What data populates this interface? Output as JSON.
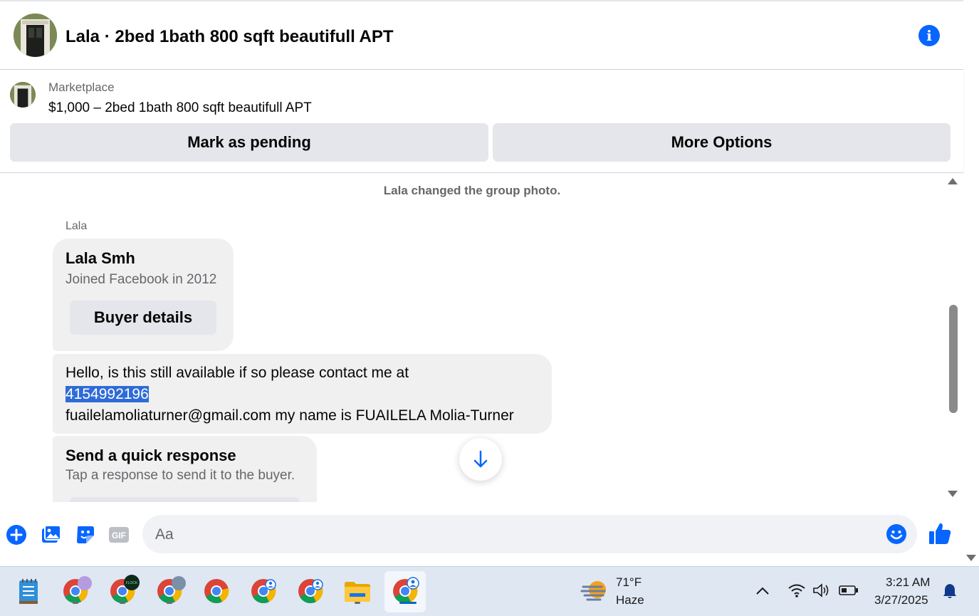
{
  "header": {
    "title": "Lala · 2bed 1bath 800 sqft beautifull APT",
    "avatar_icon": "apartment-door-photo",
    "info_icon": "info-icon",
    "info_glyph": "i"
  },
  "marketplace": {
    "label": "Marketplace",
    "listing": "$1,000 – 2bed 1bath 800 sqft beautifull APT",
    "pending_button": "Mark as pending",
    "more_button": "More Options"
  },
  "chat": {
    "system_message": "Lala changed the group photo.",
    "sender_name": "Lala",
    "profile_card": {
      "name": "Lala Smh",
      "joined": "Joined Facebook in 2012",
      "button": "Buyer details"
    },
    "message": {
      "line1": "Hello, is this still available if so please contact me at",
      "phone": "4154992196",
      "line3": "fuailelamoliaturner@gmail.com my name is FUAILELA Molia-Turner"
    },
    "quick_response": {
      "title": "Send a quick response",
      "subtitle": "Tap a response to send it to the buyer."
    }
  },
  "composer": {
    "placeholder": "Aa",
    "icons": [
      "plus-icon",
      "photo-icon",
      "sticker-icon",
      "gif-icon",
      "emoji-icon",
      "thumbs-up-icon"
    ],
    "gif_label": "GIF"
  },
  "taskbar": {
    "apps": [
      "notepad-icon",
      "chrome-profile-icon",
      "chrome-flock-icon",
      "chrome-profile-icon",
      "chrome-icon",
      "chrome-profile-icon",
      "chrome-profile-icon",
      "file-explorer-icon",
      "chrome-active-icon"
    ],
    "weather": {
      "temp": "71°F",
      "desc": "Haze"
    },
    "clock": {
      "time": "3:21 AM",
      "date": "3/27/2025"
    },
    "flock_badge": "FLOCK",
    "tray_icons": [
      "chevron-up-icon",
      "wifi-icon",
      "volume-icon",
      "battery-icon",
      "notification-bell-icon"
    ]
  },
  "colors": {
    "accent": "#0866ff",
    "bubble": "#f0f0f0",
    "button": "#e4e6eb",
    "highlight": "#2f6bd7",
    "taskbar": "#dfe7f3"
  }
}
